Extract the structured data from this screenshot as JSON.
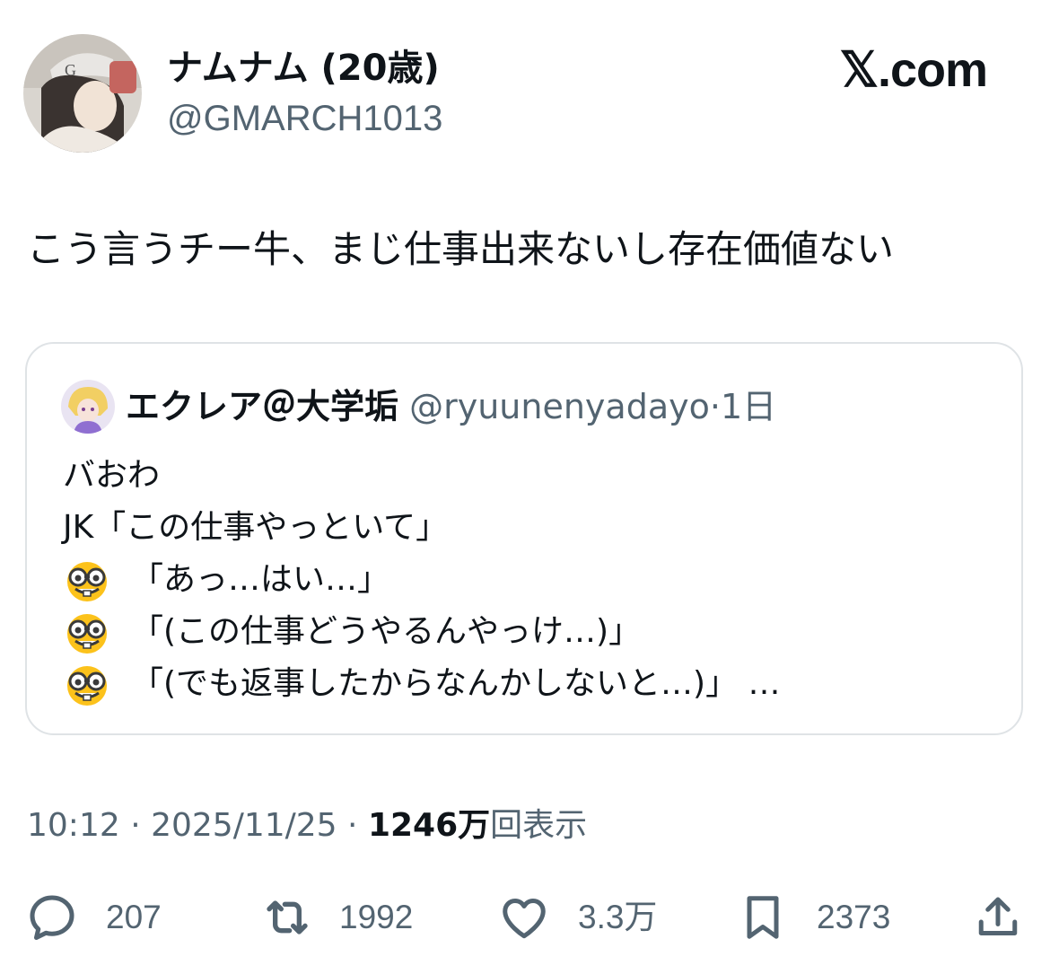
{
  "tweet": {
    "author_name": "ナムナム (20歳)",
    "author_handle": "@GMARCH1013",
    "brand": "𝕏.com",
    "text": "こう言うチー牛、まじ仕事出来ないし存在価値ない",
    "quote": {
      "author_name": "エクレア＠大学垢",
      "author_handle": "@ryuunenyadayo",
      "separator": "·",
      "time": "1日",
      "lines": [
        "バおわ",
        "JK「この仕事やっといて」",
        "「あっ…はい…」",
        "「(この仕事どうやるんやっけ…)」",
        "「(でも返事したからなんかしないと…)」 …"
      ]
    },
    "meta": {
      "time": "10:12",
      "sep1": " · ",
      "date": "2025/11/25",
      "sep2": " · ",
      "views_count": "1246万",
      "views_label": "回表示"
    },
    "actions": {
      "replies": "207",
      "retweets": "1992",
      "likes": "3.3万",
      "bookmarks": "2373"
    }
  },
  "icons": {
    "reply": "reply-icon",
    "retweet": "retweet-icon",
    "like": "heart-icon",
    "bookmark": "bookmark-icon",
    "share": "share-icon",
    "emoji": "nerd-face-emoji"
  },
  "colors": {
    "text": "#0f1419",
    "secondary": "#536471",
    "border": "#dfe3e6"
  }
}
